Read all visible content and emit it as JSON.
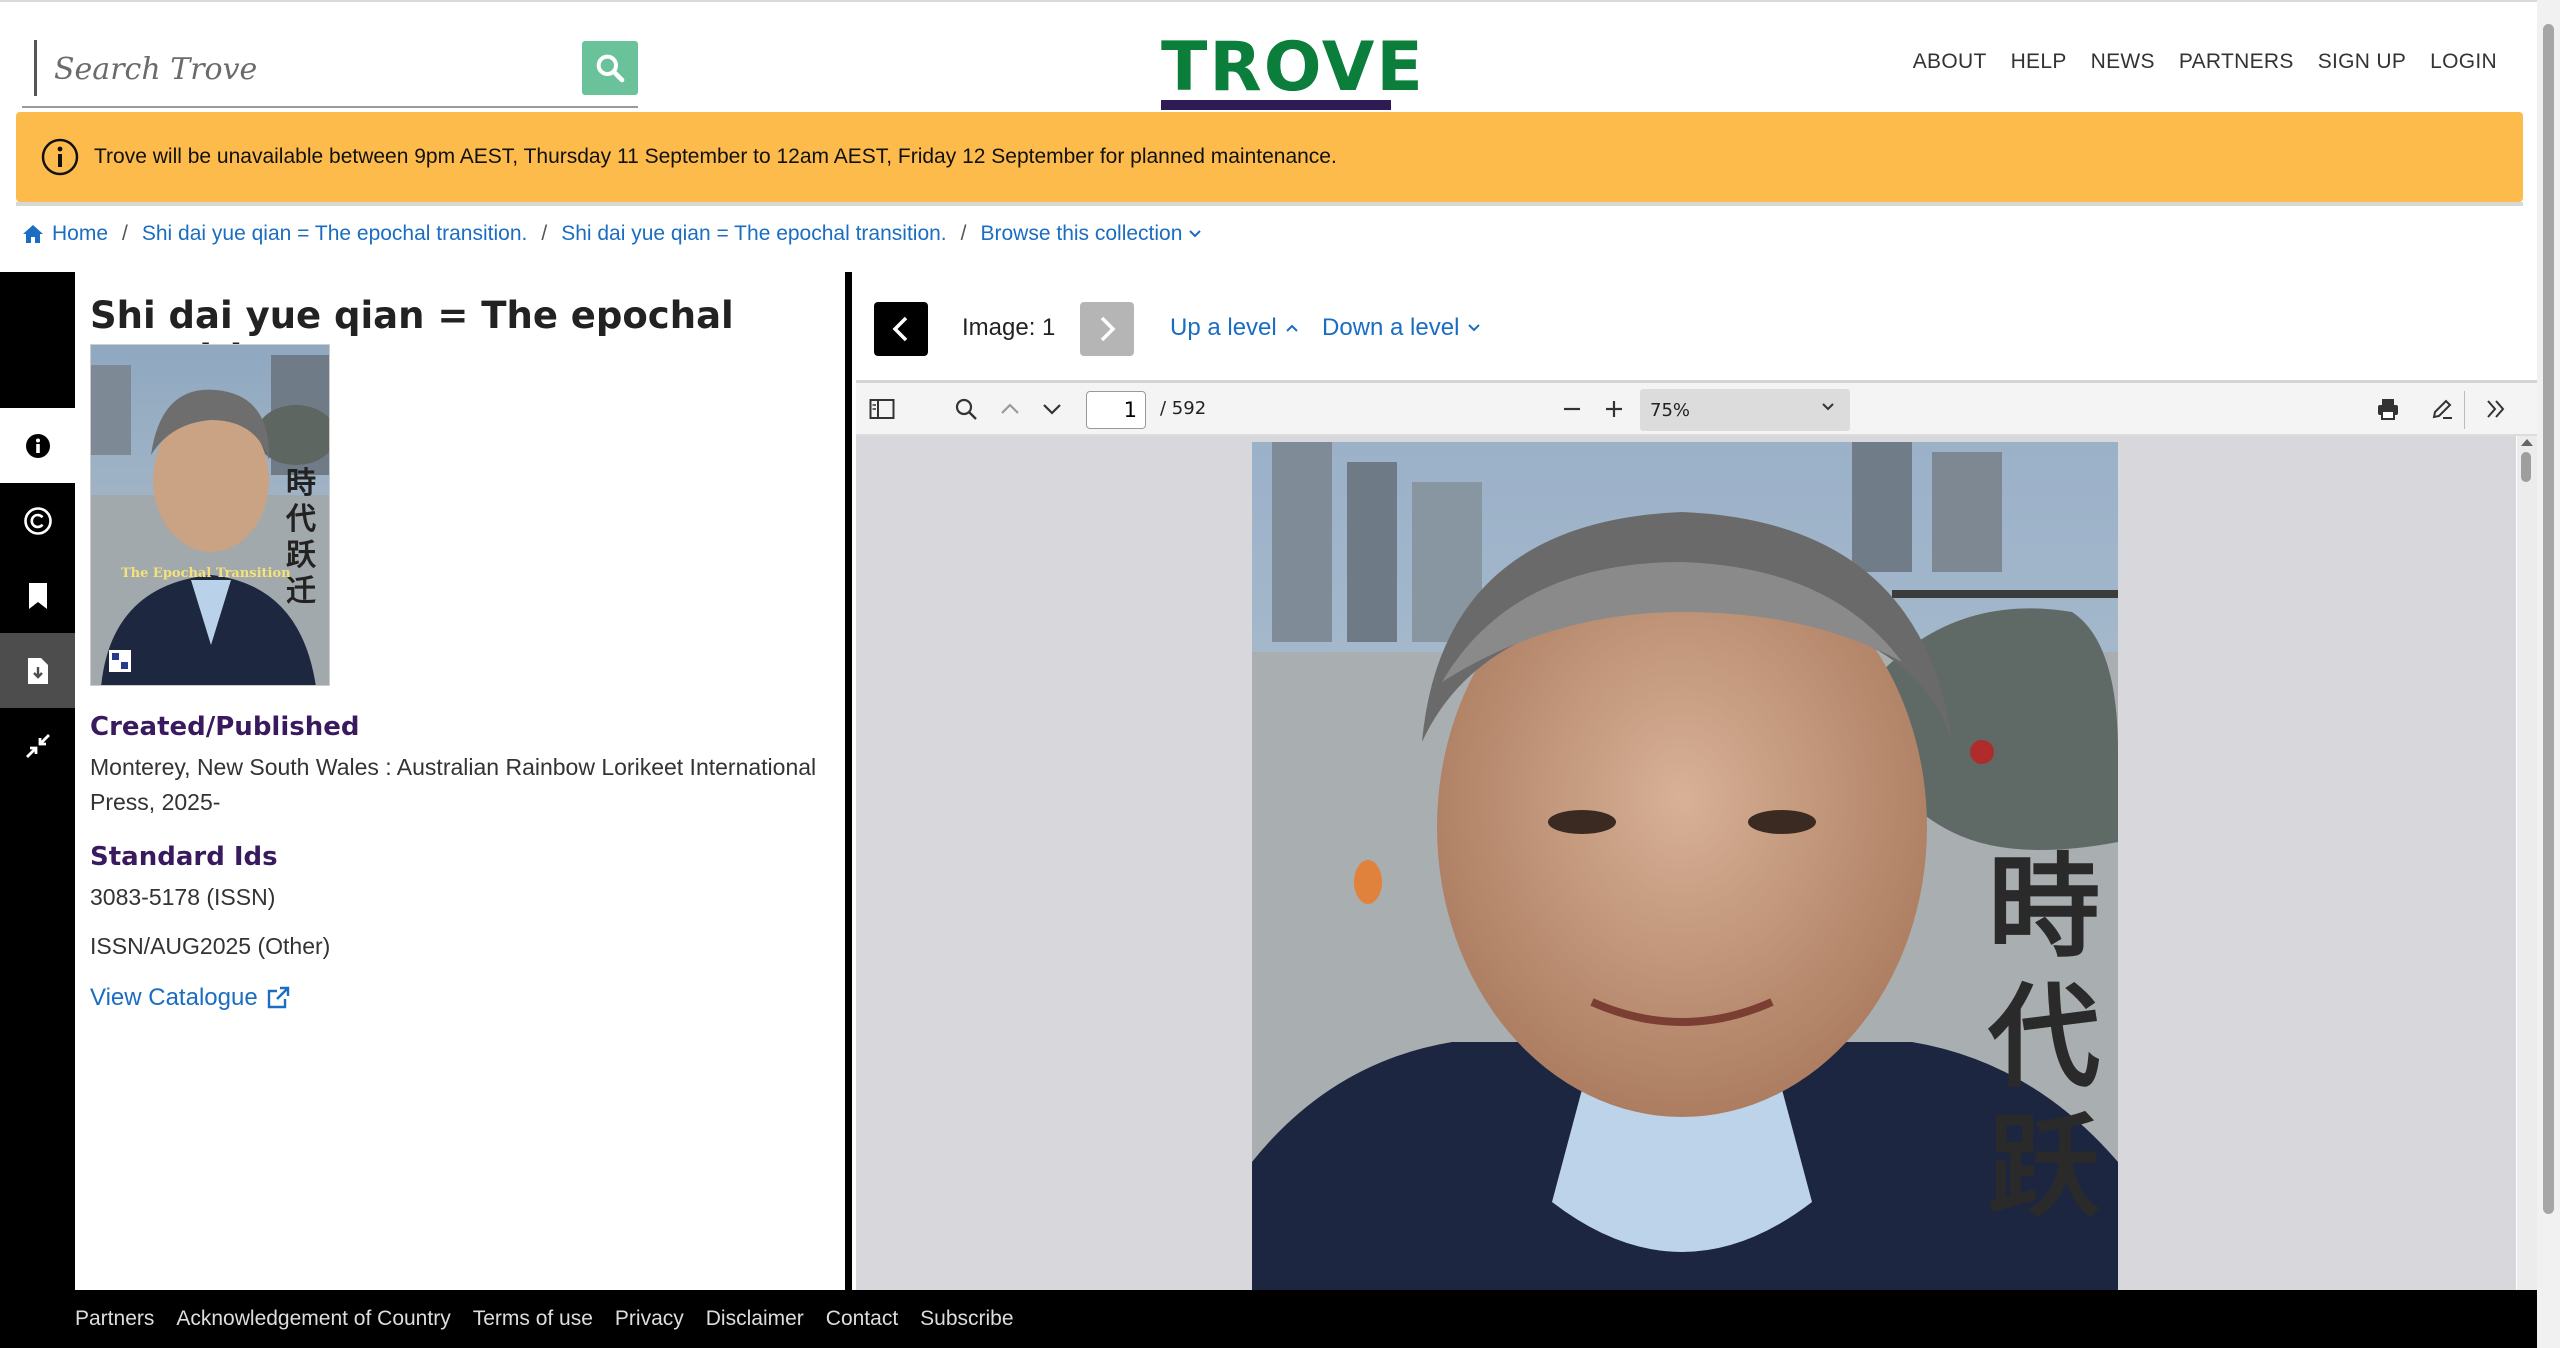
{
  "header": {
    "search_placeholder": "Search Trove",
    "logo_text": "TROVE",
    "nav": [
      "ABOUT",
      "HELP",
      "NEWS",
      "PARTNERS",
      "SIGN UP",
      "LOGIN"
    ]
  },
  "banner": {
    "text": "Trove will be unavailable between 9pm AEST, Thursday 11 September to 12am AEST, Friday 12 September for planned maintenance.",
    "color": "#fdbb4b"
  },
  "breadcrumb": {
    "home": "Home",
    "crumb1": "Shi dai yue qian = The epochal transition.",
    "crumb2": "Shi dai yue qian = The epochal transition.",
    "browse": "Browse this collection"
  },
  "rail": {
    "icons": [
      "info-icon",
      "copyright-icon",
      "bookmark-icon",
      "download-icon",
      "collapse-icon"
    ]
  },
  "details": {
    "title": "Shi dai yue qian = The epochal transition",
    "thumbnail_caption": "The Epochal Transition",
    "thumbnail_chars": "時代跃迁",
    "created_label": "Created/Published",
    "created_value": "Monterey, New South Wales : Australian Rainbow Lorikeet International Press, 2025-",
    "ids_label": "Standard Ids",
    "id1": "3083-5178 (ISSN)",
    "id2": "ISSN/AUG2025 (Other)",
    "catalogue_link": "View Catalogue"
  },
  "viewer": {
    "image_label": "Image: 1",
    "up_level": "Up a level",
    "down_level": "Down a level",
    "page_current": "1",
    "page_total": "/ 592",
    "zoom": "75%",
    "cover_chars": [
      "時",
      "代",
      "跃"
    ]
  },
  "footer": {
    "links": [
      "Partners",
      "Acknowledgement of Country",
      "Terms of use",
      "Privacy",
      "Disclaimer",
      "Contact",
      "Subscribe"
    ]
  },
  "colors": {
    "brand_green": "#0a7e3a",
    "brand_purple": "#2e1a55",
    "search_button": "#6ac29b",
    "link": "#1a6dc2",
    "heading_purple": "#3a1a5e"
  }
}
